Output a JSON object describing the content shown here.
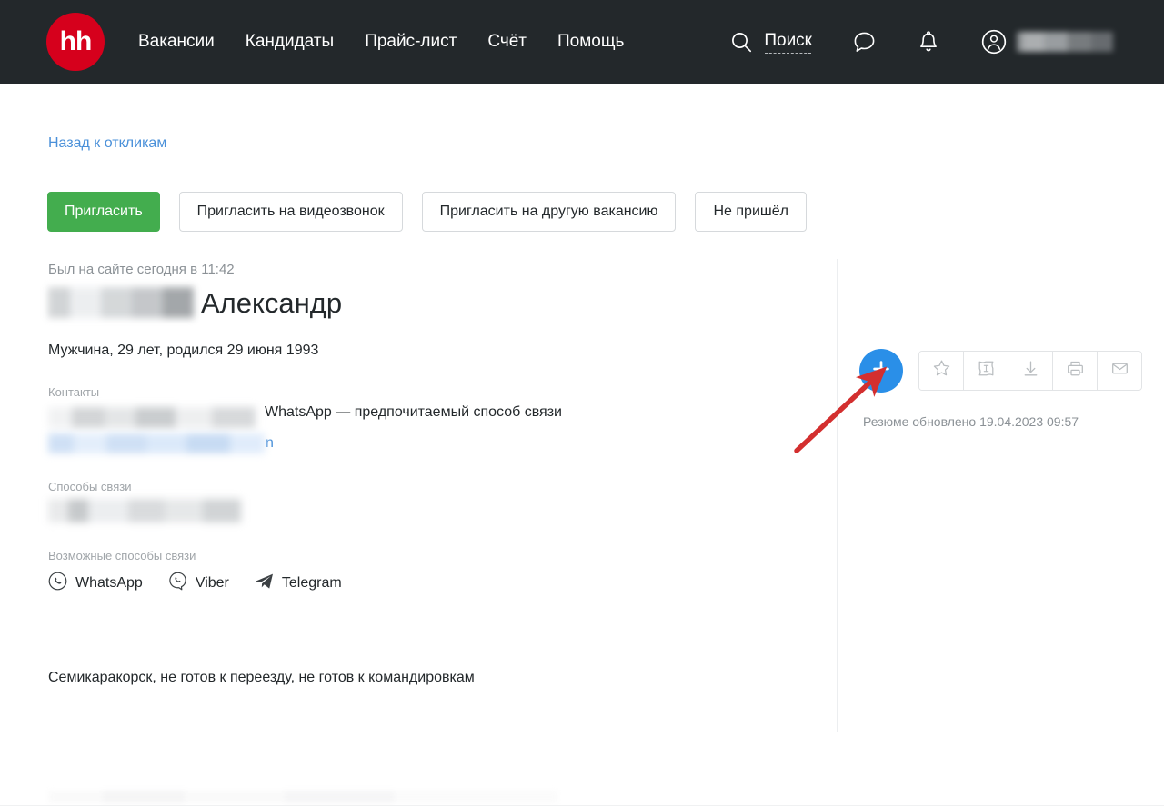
{
  "header": {
    "logo_text": "hh",
    "logo_color": "#d6001c",
    "background": "#23282b",
    "nav": [
      {
        "label": "Вакансии"
      },
      {
        "label": "Кандидаты"
      },
      {
        "label": "Прайс-лист"
      },
      {
        "label": "Счёт"
      },
      {
        "label": "Помощь"
      }
    ],
    "search_label": "Поиск",
    "icons": {
      "search": "search-icon",
      "chat": "chat-bubble-icon",
      "bell": "notification-bell-icon",
      "avatar": "user-avatar-icon"
    },
    "username_redacted": true
  },
  "main": {
    "back_link": "Назад к откликам",
    "buttons": {
      "invite": "Пригласить",
      "invite_videocall": "Пригласить на видеозвонок",
      "invite_other_vacancy": "Пригласить на другую вакансию",
      "no_show": "Не пришёл",
      "primary_color": "#43ad4e"
    },
    "candidate": {
      "last_seen": "Был на сайте сегодня в 11:42",
      "surname_redacted": true,
      "first_name": "Александр",
      "bio": "Мужчина, 29 лет, родился 29 июня 1993",
      "contacts_label": "Контакты",
      "phone_redacted": true,
      "preferred_note": "WhatsApp — предпочитаемый способ связи",
      "email_redacted": true,
      "email_visible_tail": "n",
      "contact_methods_label": "Способы связи",
      "contact_method_redacted": true,
      "possible_methods_label": "Возможные способы связи",
      "messengers": [
        {
          "label": "WhatsApp",
          "icon": "whatsapp-icon"
        },
        {
          "label": "Viber",
          "icon": "viber-icon"
        },
        {
          "label": "Telegram",
          "icon": "telegram-icon"
        }
      ],
      "location": "Семикаракорск, не готов к переезду, не готов к командировкам"
    }
  },
  "sidebar": {
    "add_button_icon": "plus-icon",
    "add_button_color": "#2a8fe8",
    "tools": [
      {
        "name": "favorite-star-icon"
      },
      {
        "name": "tag-label-icon"
      },
      {
        "name": "download-icon"
      },
      {
        "name": "print-icon"
      },
      {
        "name": "email-envelope-icon"
      }
    ],
    "resume_updated": "Резюме обновлено 19.04.2023 09:57"
  },
  "annotation": {
    "arrow_color": "#d32f2f",
    "points_to": "add-to-folder-button"
  }
}
